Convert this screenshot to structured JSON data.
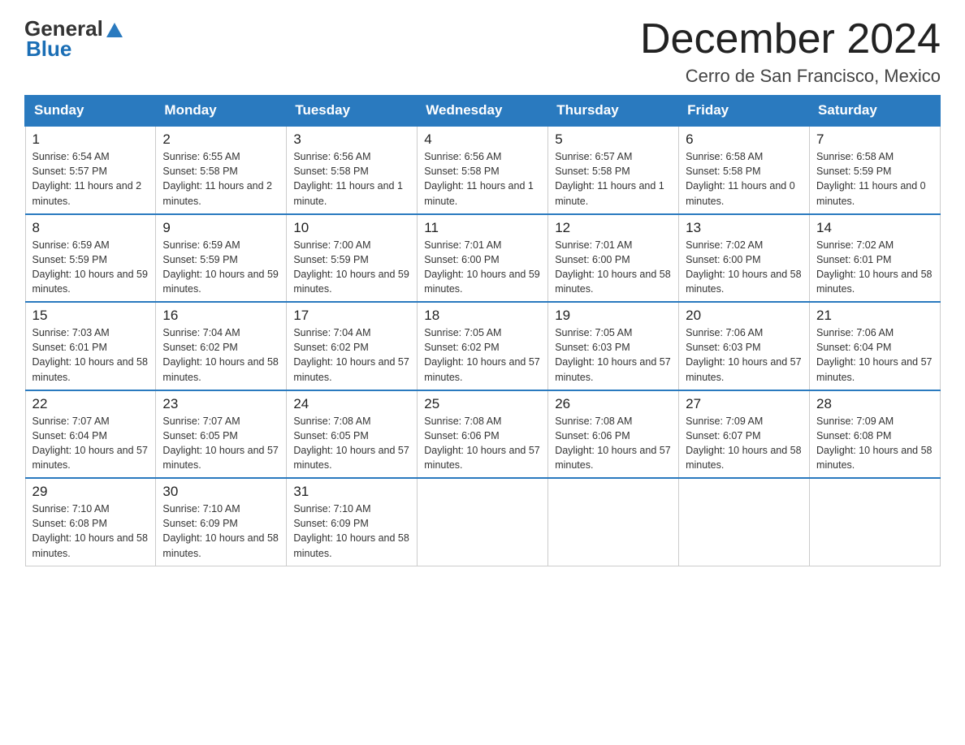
{
  "header": {
    "logo_general": "General",
    "logo_blue": "Blue",
    "month_title": "December 2024",
    "location": "Cerro de San Francisco, Mexico"
  },
  "days_of_week": [
    "Sunday",
    "Monday",
    "Tuesday",
    "Wednesday",
    "Thursday",
    "Friday",
    "Saturday"
  ],
  "weeks": [
    [
      {
        "day": "1",
        "sunrise": "6:54 AM",
        "sunset": "5:57 PM",
        "daylight": "11 hours and 2 minutes."
      },
      {
        "day": "2",
        "sunrise": "6:55 AM",
        "sunset": "5:58 PM",
        "daylight": "11 hours and 2 minutes."
      },
      {
        "day": "3",
        "sunrise": "6:56 AM",
        "sunset": "5:58 PM",
        "daylight": "11 hours and 1 minute."
      },
      {
        "day": "4",
        "sunrise": "6:56 AM",
        "sunset": "5:58 PM",
        "daylight": "11 hours and 1 minute."
      },
      {
        "day": "5",
        "sunrise": "6:57 AM",
        "sunset": "5:58 PM",
        "daylight": "11 hours and 1 minute."
      },
      {
        "day": "6",
        "sunrise": "6:58 AM",
        "sunset": "5:58 PM",
        "daylight": "11 hours and 0 minutes."
      },
      {
        "day": "7",
        "sunrise": "6:58 AM",
        "sunset": "5:59 PM",
        "daylight": "11 hours and 0 minutes."
      }
    ],
    [
      {
        "day": "8",
        "sunrise": "6:59 AM",
        "sunset": "5:59 PM",
        "daylight": "10 hours and 59 minutes."
      },
      {
        "day": "9",
        "sunrise": "6:59 AM",
        "sunset": "5:59 PM",
        "daylight": "10 hours and 59 minutes."
      },
      {
        "day": "10",
        "sunrise": "7:00 AM",
        "sunset": "5:59 PM",
        "daylight": "10 hours and 59 minutes."
      },
      {
        "day": "11",
        "sunrise": "7:01 AM",
        "sunset": "6:00 PM",
        "daylight": "10 hours and 59 minutes."
      },
      {
        "day": "12",
        "sunrise": "7:01 AM",
        "sunset": "6:00 PM",
        "daylight": "10 hours and 58 minutes."
      },
      {
        "day": "13",
        "sunrise": "7:02 AM",
        "sunset": "6:00 PM",
        "daylight": "10 hours and 58 minutes."
      },
      {
        "day": "14",
        "sunrise": "7:02 AM",
        "sunset": "6:01 PM",
        "daylight": "10 hours and 58 minutes."
      }
    ],
    [
      {
        "day": "15",
        "sunrise": "7:03 AM",
        "sunset": "6:01 PM",
        "daylight": "10 hours and 58 minutes."
      },
      {
        "day": "16",
        "sunrise": "7:04 AM",
        "sunset": "6:02 PM",
        "daylight": "10 hours and 58 minutes."
      },
      {
        "day": "17",
        "sunrise": "7:04 AM",
        "sunset": "6:02 PM",
        "daylight": "10 hours and 57 minutes."
      },
      {
        "day": "18",
        "sunrise": "7:05 AM",
        "sunset": "6:02 PM",
        "daylight": "10 hours and 57 minutes."
      },
      {
        "day": "19",
        "sunrise": "7:05 AM",
        "sunset": "6:03 PM",
        "daylight": "10 hours and 57 minutes."
      },
      {
        "day": "20",
        "sunrise": "7:06 AM",
        "sunset": "6:03 PM",
        "daylight": "10 hours and 57 minutes."
      },
      {
        "day": "21",
        "sunrise": "7:06 AM",
        "sunset": "6:04 PM",
        "daylight": "10 hours and 57 minutes."
      }
    ],
    [
      {
        "day": "22",
        "sunrise": "7:07 AM",
        "sunset": "6:04 PM",
        "daylight": "10 hours and 57 minutes."
      },
      {
        "day": "23",
        "sunrise": "7:07 AM",
        "sunset": "6:05 PM",
        "daylight": "10 hours and 57 minutes."
      },
      {
        "day": "24",
        "sunrise": "7:08 AM",
        "sunset": "6:05 PM",
        "daylight": "10 hours and 57 minutes."
      },
      {
        "day": "25",
        "sunrise": "7:08 AM",
        "sunset": "6:06 PM",
        "daylight": "10 hours and 57 minutes."
      },
      {
        "day": "26",
        "sunrise": "7:08 AM",
        "sunset": "6:06 PM",
        "daylight": "10 hours and 57 minutes."
      },
      {
        "day": "27",
        "sunrise": "7:09 AM",
        "sunset": "6:07 PM",
        "daylight": "10 hours and 58 minutes."
      },
      {
        "day": "28",
        "sunrise": "7:09 AM",
        "sunset": "6:08 PM",
        "daylight": "10 hours and 58 minutes."
      }
    ],
    [
      {
        "day": "29",
        "sunrise": "7:10 AM",
        "sunset": "6:08 PM",
        "daylight": "10 hours and 58 minutes."
      },
      {
        "day": "30",
        "sunrise": "7:10 AM",
        "sunset": "6:09 PM",
        "daylight": "10 hours and 58 minutes."
      },
      {
        "day": "31",
        "sunrise": "7:10 AM",
        "sunset": "6:09 PM",
        "daylight": "10 hours and 58 minutes."
      },
      null,
      null,
      null,
      null
    ]
  ]
}
